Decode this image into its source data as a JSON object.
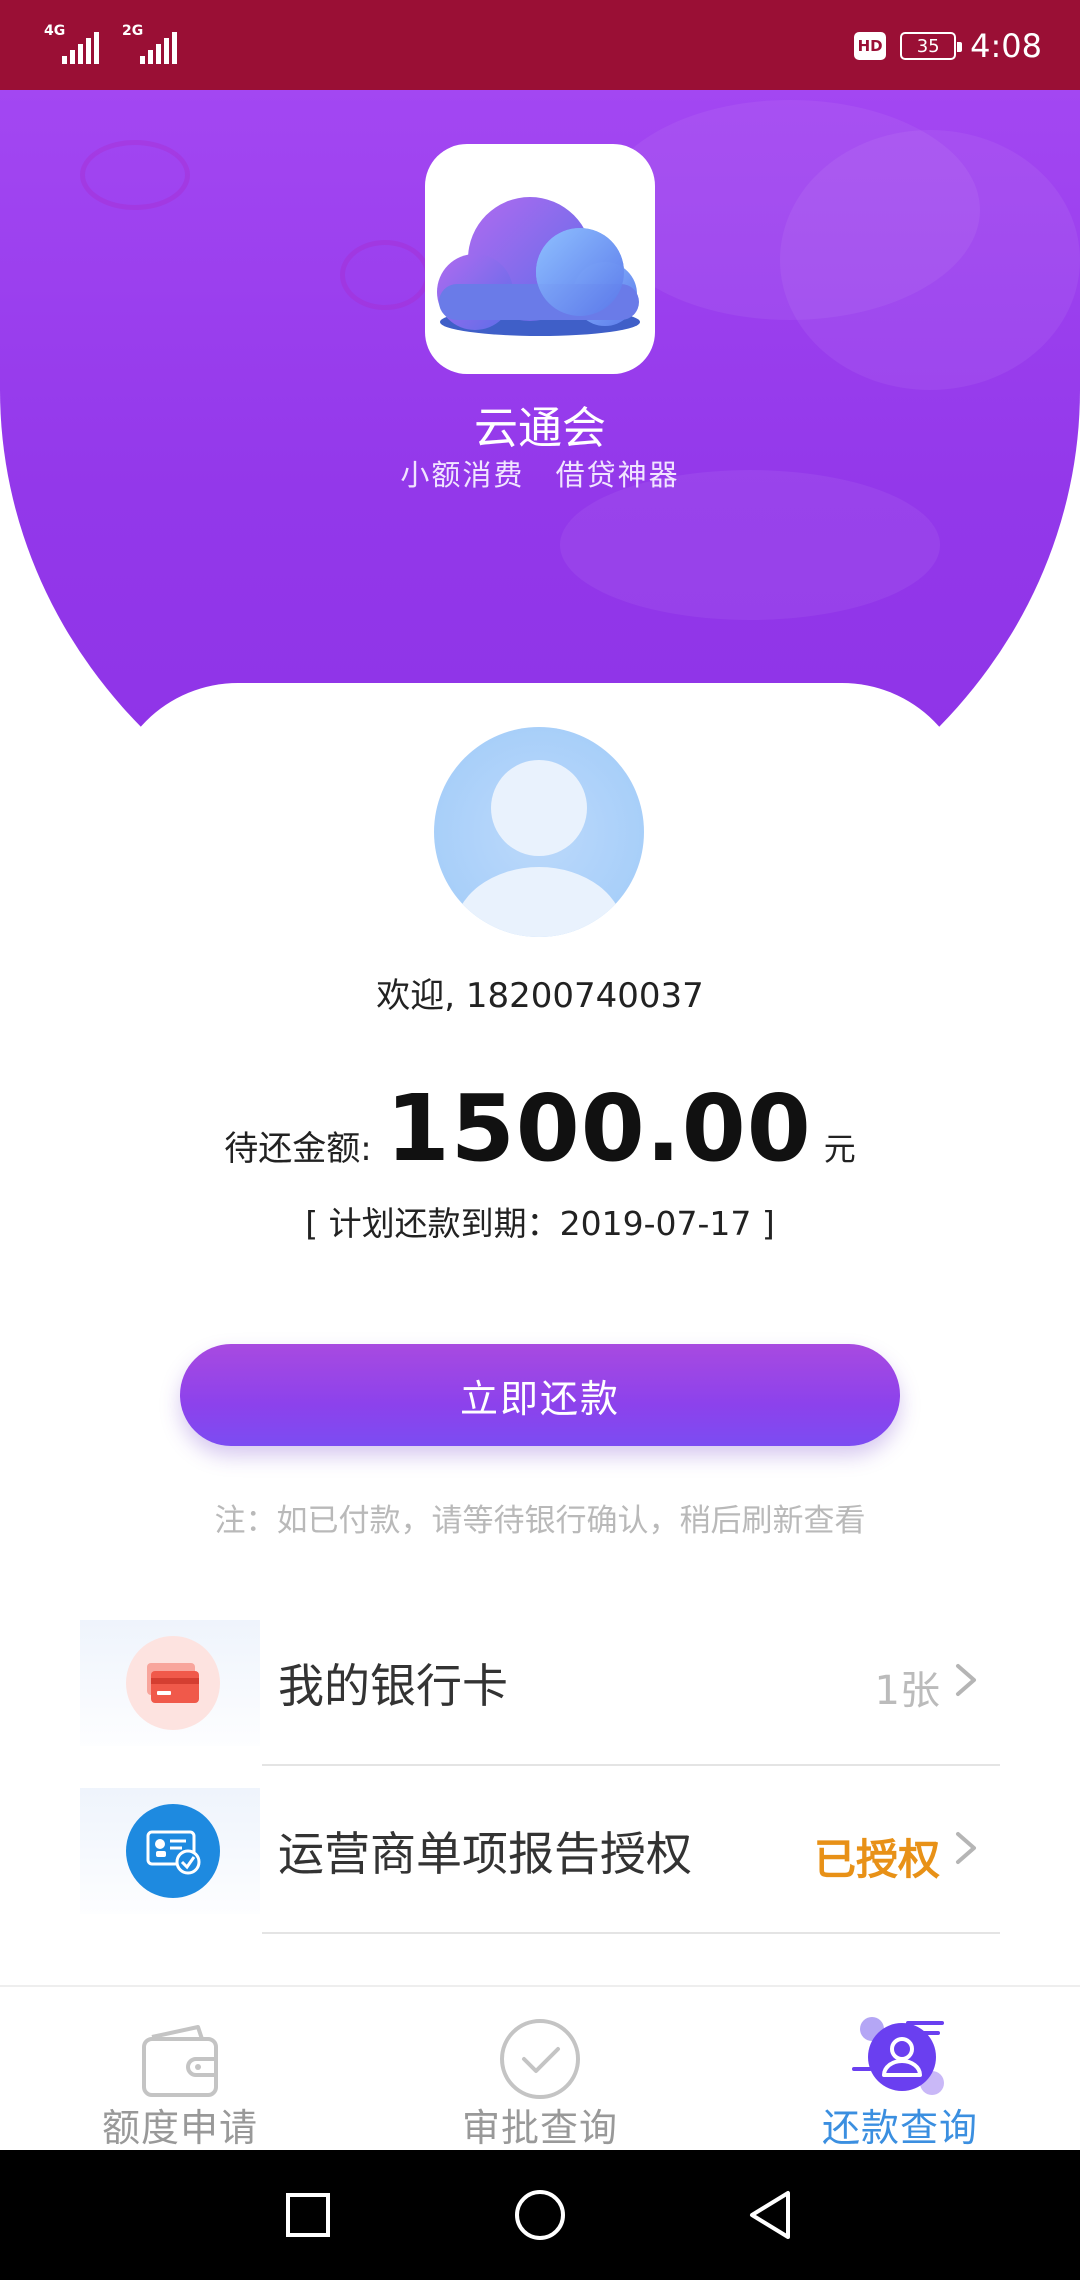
{
  "status_bar": {
    "network_1": "4G",
    "network_2": "2G",
    "hd_badge": "HD",
    "battery_level": "35",
    "time": "4:08"
  },
  "app": {
    "name": "云通会",
    "slogan_1": "小额消费",
    "slogan_2": "借贷神器"
  },
  "account": {
    "welcome": "欢迎, 18200740037",
    "amount_label": "待还金额:",
    "amount_value": "1500.00",
    "amount_unit": "元",
    "due_date": "[ 计划还款到期：2019-07-17 ]"
  },
  "actions": {
    "pay_now": "立即还款",
    "note": "注：如已付款，请等待银行确认，稍后刷新查看"
  },
  "menu": [
    {
      "label": "我的银行卡",
      "value": "1张"
    },
    {
      "label": "运营商单项报告授权",
      "value": "已授权"
    }
  ],
  "tabs": [
    {
      "label": "额度申请"
    },
    {
      "label": "审批查询"
    },
    {
      "label": "还款查询"
    }
  ],
  "colors": {
    "status_bar": "#9a0f35",
    "hero_purple": "#9338ea",
    "accent_blue": "#3b8fe0",
    "authorized_gold": "#e89117"
  }
}
